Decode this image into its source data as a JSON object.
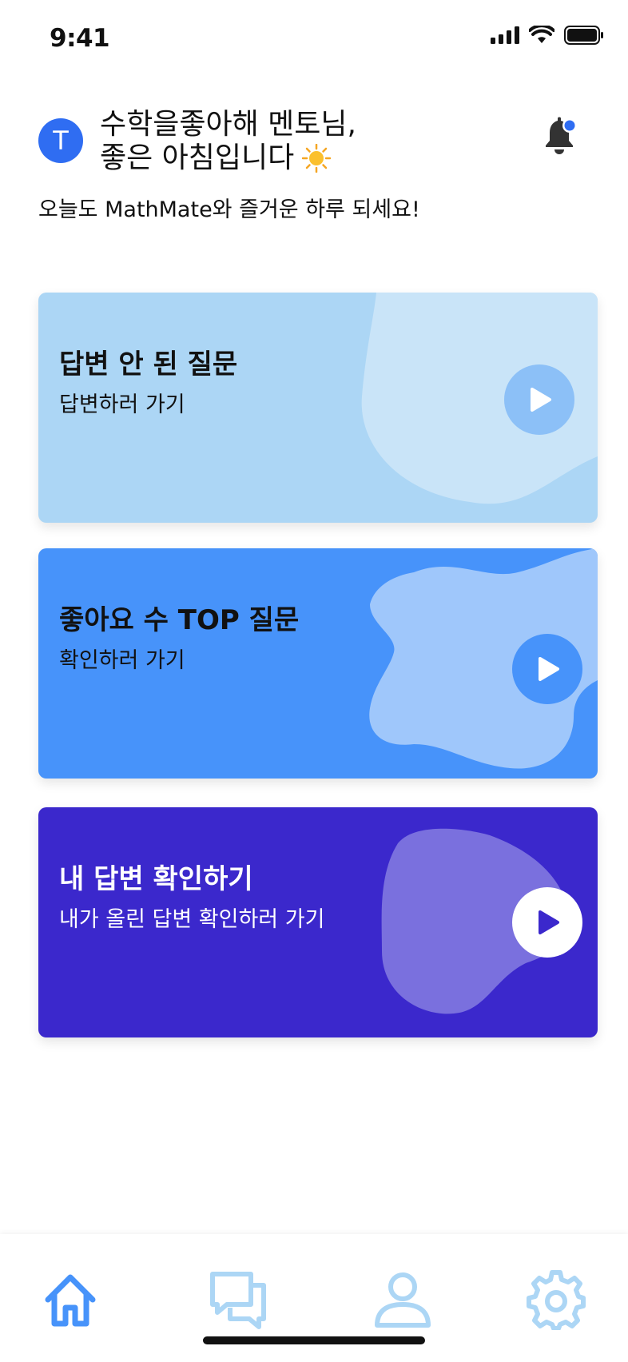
{
  "status_bar": {
    "time": "9:41"
  },
  "header": {
    "avatar_letter": "T",
    "greeting_line1": "수학을좋아해 멘토님,",
    "greeting_line2": "좋은 아침입니다",
    "subtitle": "오늘도 MathMate와 즐거운 하루 되세요!",
    "notification_dot": true
  },
  "cards": [
    {
      "title": "답변 안 된 질문",
      "desc": "답변하러 가기",
      "bg": "#acd6f5",
      "blob": "#c9e4f8",
      "play_bg": "#8cc0f7",
      "play_icon": "#ffffff",
      "text": "#111111"
    },
    {
      "title": "좋아요 수 TOP 질문",
      "desc": "확인하러 가기",
      "bg": "#4793fa",
      "blob": "#9fc7fb",
      "play_bg": "#4793fa",
      "play_icon": "#ffffff",
      "text": "#111111"
    },
    {
      "title": "내 답변 확인하기",
      "desc": "내가 올린 답변 확인하러 가기",
      "bg": "#3b28cc",
      "blob": "#7a70de",
      "play_bg": "#ffffff",
      "play_icon": "#3b28cc",
      "text": "#ffffff"
    }
  ],
  "tabbar": {
    "tabs": [
      {
        "name": "home",
        "icon": "home-icon",
        "active": true
      },
      {
        "name": "chat",
        "icon": "chat-icon",
        "active": false
      },
      {
        "name": "profile",
        "icon": "user-icon",
        "active": false
      },
      {
        "name": "settings",
        "icon": "gear-icon",
        "active": false
      }
    ],
    "active_color": "#4793fa",
    "inactive_color": "#acd6f5"
  }
}
